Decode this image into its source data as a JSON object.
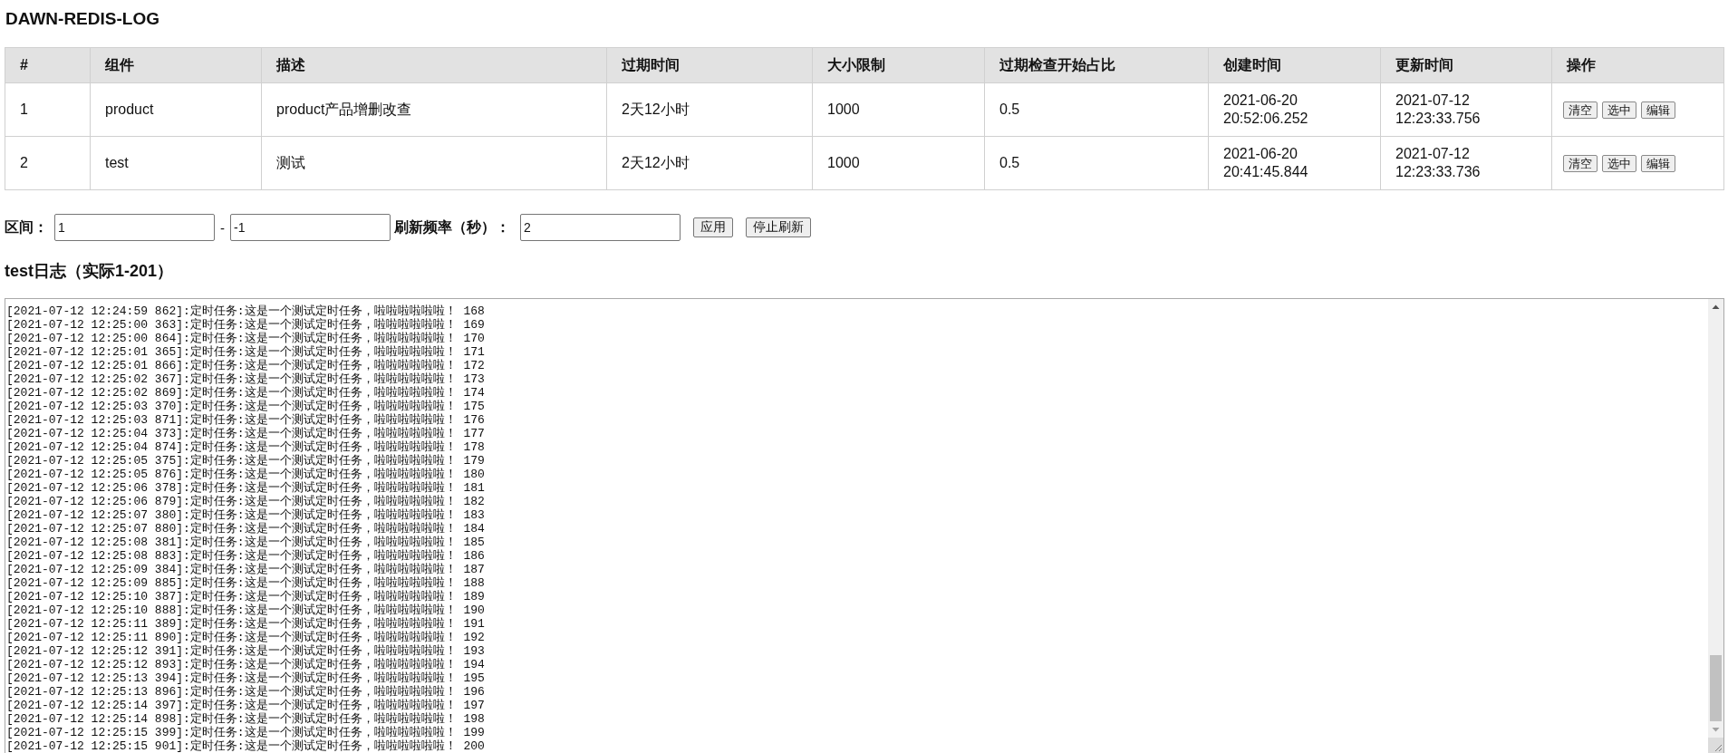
{
  "title": "DAWN-REDIS-LOG",
  "table": {
    "columns": [
      "#",
      "组件",
      "描述",
      "过期时间",
      "大小限制",
      "过期检查开始占比",
      "创建时间",
      "更新时间",
      "操作"
    ],
    "rows": [
      {
        "cells": [
          "1",
          "product",
          "product产品增删改查",
          "2天12小时",
          "1000",
          "0.5",
          "2021-06-20 20:52:06.252",
          "2021-07-12 12:23:33.756"
        ],
        "actions": [
          "清空",
          "选中",
          "编辑"
        ]
      },
      {
        "cells": [
          "2",
          "test",
          "测试",
          "2天12小时",
          "1000",
          "0.5",
          "2021-06-20 20:41:45.844",
          "2021-07-12 12:23:33.736"
        ],
        "actions": [
          "清空",
          "选中",
          "编辑"
        ]
      }
    ]
  },
  "controls": {
    "range_label": "区间：",
    "range_from": "1",
    "range_separator": "-",
    "range_to": "-1",
    "refresh_label": "刷新频率（秒）：",
    "refresh_value": "2",
    "apply_button": "应用",
    "stop_refresh_button": "停止刷新"
  },
  "log": {
    "title": "test日志（实际1-201）",
    "lines": [
      "[2021-07-12 12:24:59 862]:定时任务:这是一个测试定时任务，啦啦啦啦啦啦！ 168",
      "[2021-07-12 12:25:00 363]:定时任务:这是一个测试定时任务，啦啦啦啦啦啦！ 169",
      "[2021-07-12 12:25:00 864]:定时任务:这是一个测试定时任务，啦啦啦啦啦啦！ 170",
      "[2021-07-12 12:25:01 365]:定时任务:这是一个测试定时任务，啦啦啦啦啦啦！ 171",
      "[2021-07-12 12:25:01 866]:定时任务:这是一个测试定时任务，啦啦啦啦啦啦！ 172",
      "[2021-07-12 12:25:02 367]:定时任务:这是一个测试定时任务，啦啦啦啦啦啦！ 173",
      "[2021-07-12 12:25:02 869]:定时任务:这是一个测试定时任务，啦啦啦啦啦啦！ 174",
      "[2021-07-12 12:25:03 370]:定时任务:这是一个测试定时任务，啦啦啦啦啦啦！ 175",
      "[2021-07-12 12:25:03 871]:定时任务:这是一个测试定时任务，啦啦啦啦啦啦！ 176",
      "[2021-07-12 12:25:04 373]:定时任务:这是一个测试定时任务，啦啦啦啦啦啦！ 177",
      "[2021-07-12 12:25:04 874]:定时任务:这是一个测试定时任务，啦啦啦啦啦啦！ 178",
      "[2021-07-12 12:25:05 375]:定时任务:这是一个测试定时任务，啦啦啦啦啦啦！ 179",
      "[2021-07-12 12:25:05 876]:定时任务:这是一个测试定时任务，啦啦啦啦啦啦！ 180",
      "[2021-07-12 12:25:06 378]:定时任务:这是一个测试定时任务，啦啦啦啦啦啦！ 181",
      "[2021-07-12 12:25:06 879]:定时任务:这是一个测试定时任务，啦啦啦啦啦啦！ 182",
      "[2021-07-12 12:25:07 380]:定时任务:这是一个测试定时任务，啦啦啦啦啦啦！ 183",
      "[2021-07-12 12:25:07 880]:定时任务:这是一个测试定时任务，啦啦啦啦啦啦！ 184",
      "[2021-07-12 12:25:08 381]:定时任务:这是一个测试定时任务，啦啦啦啦啦啦！ 185",
      "[2021-07-12 12:25:08 883]:定时任务:这是一个测试定时任务，啦啦啦啦啦啦！ 186",
      "[2021-07-12 12:25:09 384]:定时任务:这是一个测试定时任务，啦啦啦啦啦啦！ 187",
      "[2021-07-12 12:25:09 885]:定时任务:这是一个测试定时任务，啦啦啦啦啦啦！ 188",
      "[2021-07-12 12:25:10 387]:定时任务:这是一个测试定时任务，啦啦啦啦啦啦！ 189",
      "[2021-07-12 12:25:10 888]:定时任务:这是一个测试定时任务，啦啦啦啦啦啦！ 190",
      "[2021-07-12 12:25:11 389]:定时任务:这是一个测试定时任务，啦啦啦啦啦啦！ 191",
      "[2021-07-12 12:25:11 890]:定时任务:这是一个测试定时任务，啦啦啦啦啦啦！ 192",
      "[2021-07-12 12:25:12 391]:定时任务:这是一个测试定时任务，啦啦啦啦啦啦！ 193",
      "[2021-07-12 12:25:12 893]:定时任务:这是一个测试定时任务，啦啦啦啦啦啦！ 194",
      "[2021-07-12 12:25:13 394]:定时任务:这是一个测试定时任务，啦啦啦啦啦啦！ 195",
      "[2021-07-12 12:25:13 896]:定时任务:这是一个测试定时任务，啦啦啦啦啦啦！ 196",
      "[2021-07-12 12:25:14 397]:定时任务:这是一个测试定时任务，啦啦啦啦啦啦！ 197",
      "[2021-07-12 12:25:14 898]:定时任务:这是一个测试定时任务，啦啦啦啦啦啦！ 198",
      "[2021-07-12 12:25:15 399]:定时任务:这是一个测试定时任务，啦啦啦啦啦啦！ 199",
      "[2021-07-12 12:25:15 901]:定时任务:这是一个测试定时任务，啦啦啦啦啦啦！ 200"
    ]
  }
}
